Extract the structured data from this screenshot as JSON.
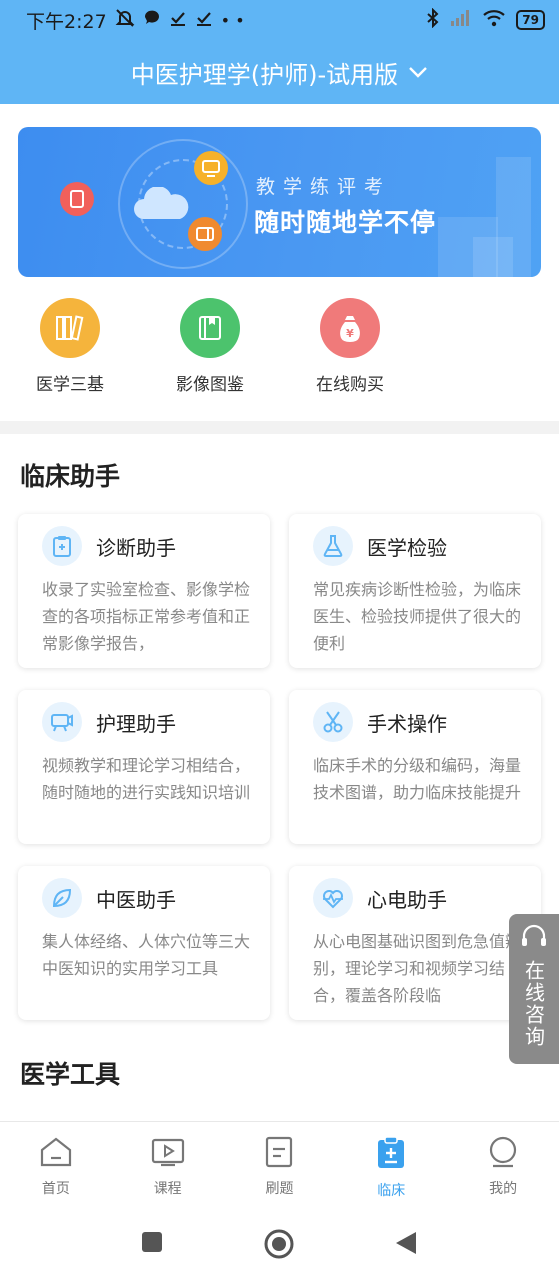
{
  "status_bar": {
    "time": "下午2:27",
    "battery": "79"
  },
  "header": {
    "title": "中医护理学(护师)-试用版"
  },
  "banner": {
    "line1": "教学练评考",
    "line2": "随时随地学不停"
  },
  "quick_items": [
    {
      "label": "医学三基",
      "color": "#f5b43c",
      "icon": "books-icon"
    },
    {
      "label": "影像图鉴",
      "color": "#4cc36d",
      "icon": "album-icon"
    },
    {
      "label": "在线购买",
      "color": "#f07a7a",
      "icon": "money-bag-icon"
    }
  ],
  "sections": {
    "clinical": "临床助手",
    "tools": "医学工具"
  },
  "cards": [
    {
      "title": "诊断助手",
      "desc": "收录了实验室检查、影像学检查的各项指标正常参考值和正常影像学报告，",
      "icon": "clipboard-icon"
    },
    {
      "title": "医学检验",
      "desc": "常见疾病诊断性检验，为临床医生、检验技师提供了很大的便利",
      "icon": "flask-icon"
    },
    {
      "title": "护理助手",
      "desc": "视频教学和理论学习相结合，随时随地的进行实践知识培训",
      "icon": "video-camera-icon"
    },
    {
      "title": "手术操作",
      "desc": "临床手术的分级和编码，海量技术图谱，助力临床技能提升",
      "icon": "scissors-icon"
    },
    {
      "title": "中医助手",
      "desc": "集人体经络、人体穴位等三大中医知识的实用学习工具",
      "icon": "leaf-icon"
    },
    {
      "title": "心电助手",
      "desc": "从心电图基础识图到危急值辨别，理论学习和视频学习结合，覆盖各阶段临",
      "icon": "heartbeat-icon"
    }
  ],
  "consult": {
    "label": "在线咨询"
  },
  "bottom_nav": [
    {
      "label": "首页",
      "icon": "home-icon",
      "active": false
    },
    {
      "label": "课程",
      "icon": "play-icon",
      "active": false
    },
    {
      "label": "刷题",
      "icon": "document-icon",
      "active": false
    },
    {
      "label": "临床",
      "icon": "clinical-clipboard-icon",
      "active": true
    },
    {
      "label": "我的",
      "icon": "user-icon",
      "active": false
    }
  ],
  "colors": {
    "primary": "#5fb5f5",
    "active_nav": "#3aa1ee",
    "card_icon_bg": "#e7f3fd"
  }
}
